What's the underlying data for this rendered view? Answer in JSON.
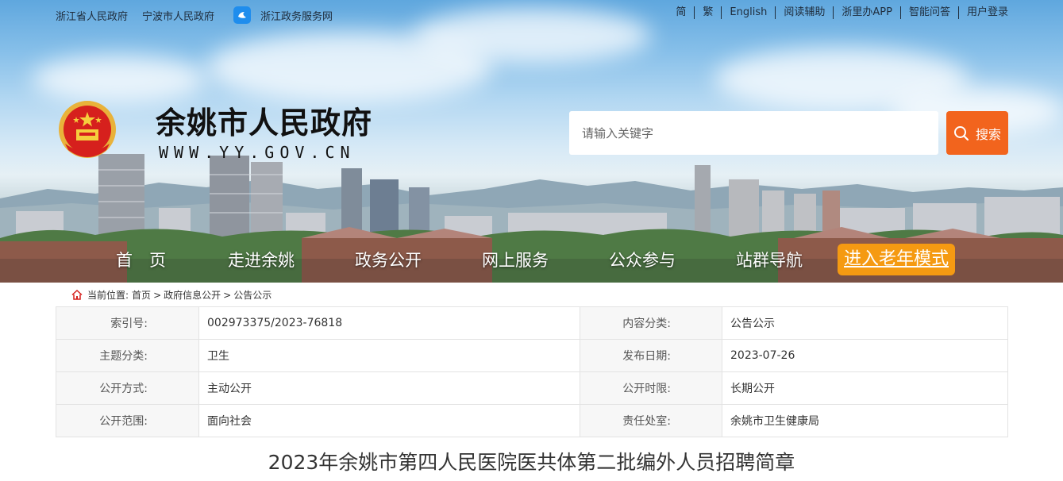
{
  "topbar": {
    "left_links": [
      "浙江省人民政府",
      "宁波市人民政府"
    ],
    "zjzw_label": "浙江政务服务网",
    "right_links": [
      "简",
      "繁",
      "English",
      "阅读辅助",
      "浙里办APP",
      "智能问答",
      "用户登录"
    ]
  },
  "site": {
    "title": "余姚市人民政府",
    "url": "WWW.YY.GOV.CN"
  },
  "search": {
    "placeholder": "请输入关键字",
    "button_label": "搜索"
  },
  "nav": {
    "items": [
      "首　页",
      "走进余姚",
      "政务公开",
      "网上服务",
      "公众参与",
      "站群导航"
    ],
    "elder_mode": "进入老年模式"
  },
  "breadcrumb": {
    "prefix": "当前位置:",
    "items": [
      "首页",
      "政府信息公开",
      "公告公示"
    ],
    "separator": ">"
  },
  "info": {
    "rows": [
      {
        "k1": "索引号:",
        "v1": "002973375/2023-76818",
        "k2": "内容分类:",
        "v2": "公告公示"
      },
      {
        "k1": "主题分类:",
        "v1": "卫生",
        "k2": "发布日期:",
        "v2": "2023-07-26"
      },
      {
        "k1": "公开方式:",
        "v1": "主动公开",
        "k2": "公开时限:",
        "v2": "长期公开"
      },
      {
        "k1": "公开范围:",
        "v1": "面向社会",
        "k2": "责任处室:",
        "v2": "余姚市卫生健康局"
      }
    ]
  },
  "article": {
    "title": "2023年余姚市第四人民医院医共体第二批编外人员招聘简章"
  },
  "colors": {
    "search_button": "#f2641d",
    "elder_button": "#f59a12",
    "sky_top": "#5fa7de"
  }
}
